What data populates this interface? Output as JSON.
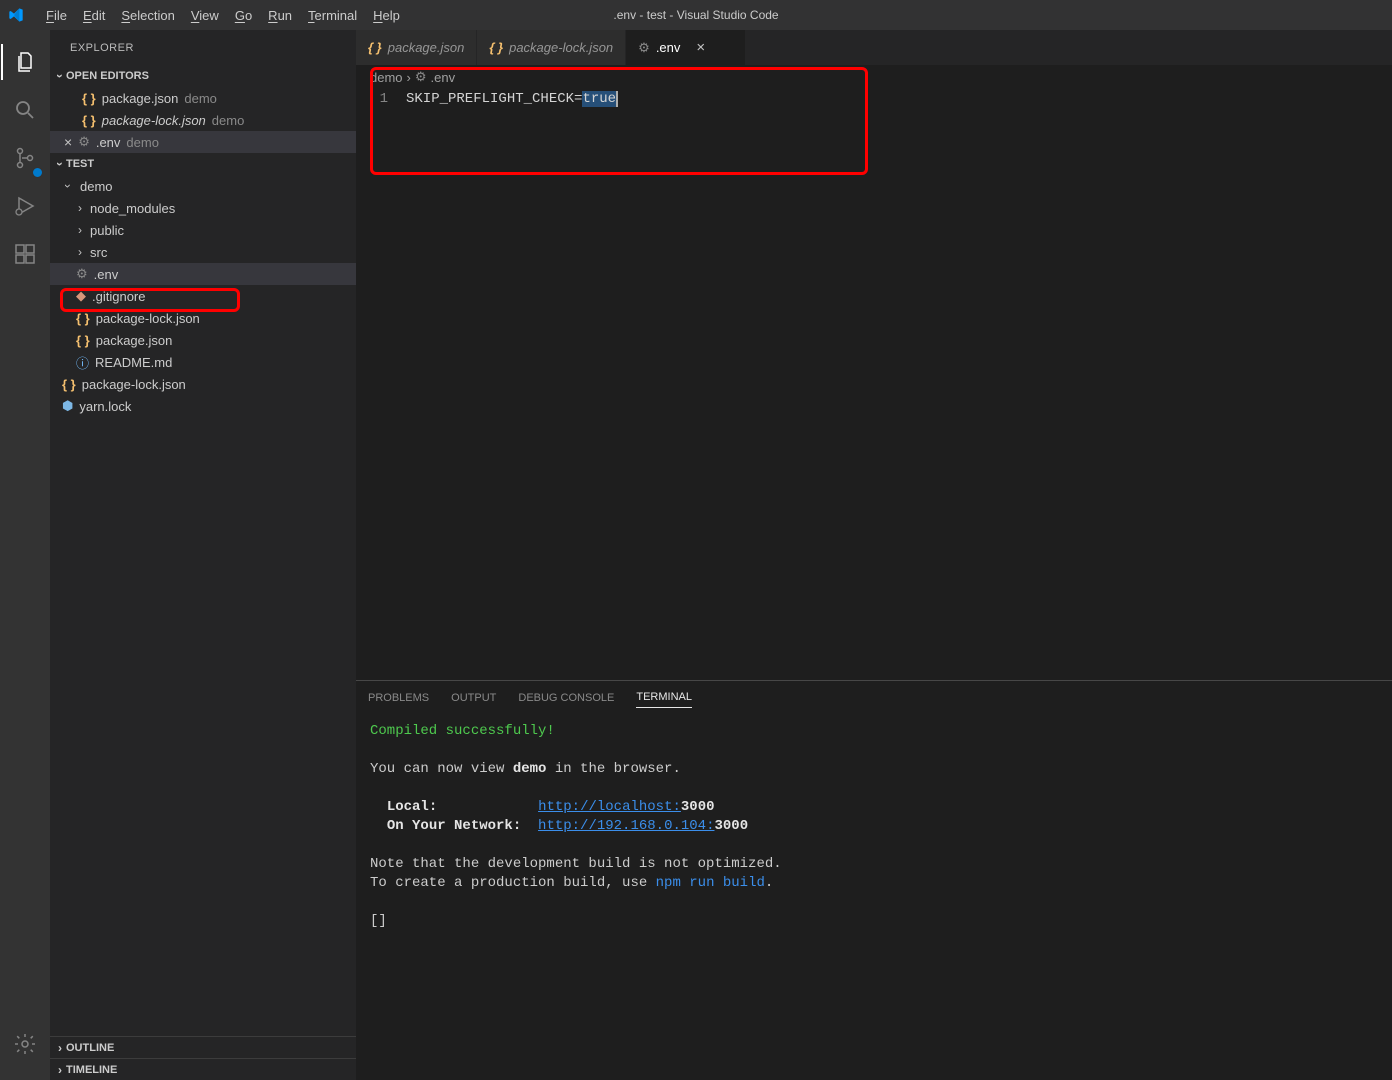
{
  "title": ".env - test - Visual Studio Code",
  "menu": [
    "File",
    "Edit",
    "Selection",
    "View",
    "Go",
    "Run",
    "Terminal",
    "Help"
  ],
  "sidebar": {
    "header": "EXPLORER",
    "openEditors": {
      "label": "OPEN EDITORS",
      "items": [
        {
          "name": "package.json",
          "sub": "demo",
          "icon": "braces"
        },
        {
          "name": "package-lock.json",
          "sub": "demo",
          "icon": "braces",
          "italic": true
        },
        {
          "name": ".env",
          "sub": "demo",
          "icon": "gear",
          "active": true,
          "close": true
        }
      ]
    },
    "workspace": {
      "label": "TEST",
      "tree": [
        {
          "name": "demo",
          "type": "folder",
          "depth": 0,
          "expanded": true
        },
        {
          "name": "node_modules",
          "type": "folder",
          "depth": 1
        },
        {
          "name": "public",
          "type": "folder",
          "depth": 1
        },
        {
          "name": "src",
          "type": "folder",
          "depth": 1
        },
        {
          "name": ".env",
          "type": "file",
          "icon": "gear",
          "depth": 1,
          "active": true
        },
        {
          "name": ".gitignore",
          "type": "file",
          "icon": "dot",
          "depth": 1
        },
        {
          "name": "package-lock.json",
          "type": "file",
          "icon": "braces",
          "depth": 1
        },
        {
          "name": "package.json",
          "type": "file",
          "icon": "braces",
          "depth": 1
        },
        {
          "name": "README.md",
          "type": "file",
          "icon": "info",
          "depth": 1
        },
        {
          "name": "package-lock.json",
          "type": "file",
          "icon": "braces",
          "depth": 0
        },
        {
          "name": "yarn.lock",
          "type": "file",
          "icon": "yarn",
          "depth": 0
        }
      ]
    },
    "outline": "OUTLINE",
    "timeline": "TIMELINE"
  },
  "tabs": [
    {
      "name": "package.json",
      "icon": "braces"
    },
    {
      "name": "package-lock.json",
      "icon": "braces",
      "italic": true
    },
    {
      "name": ".env",
      "icon": "gear",
      "active": true
    }
  ],
  "breadcrumb": {
    "path": "demo",
    "file": ".env"
  },
  "editor": {
    "lineNum": "1",
    "content": "SKIP_PREFLIGHT_CHECK=",
    "highlighted": "true"
  },
  "terminal": {
    "tabs": [
      "PROBLEMS",
      "OUTPUT",
      "DEBUG CONSOLE",
      "TERMINAL"
    ],
    "activeTab": 3,
    "compileMsg": "Compiled successfully!",
    "viewLine1": "You can now view ",
    "viewBold": "demo",
    "viewLine2": " in the browser.",
    "localLabel": "Local:",
    "localUrl": "http://localhost:",
    "localPort": "3000",
    "networkLabel": "On Your Network:",
    "networkUrl": "http://192.168.0.104:",
    "networkPort": "3000",
    "note1": "Note that the development build is not optimized.",
    "note2a": "To create a production build, use ",
    "note2b": "npm run build",
    "note2c": ".",
    "cursor": "[]"
  }
}
